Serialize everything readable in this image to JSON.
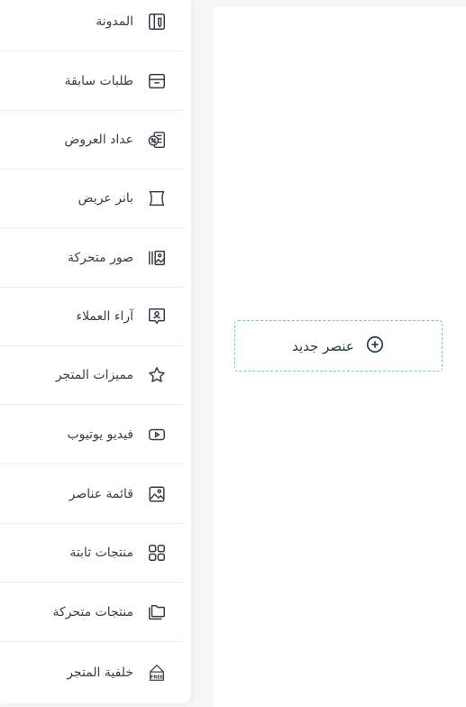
{
  "menu": {
    "items": [
      {
        "label": "المدونة",
        "icon": "blog-icon"
      },
      {
        "label": "طلبات سابقة",
        "icon": "box-icon"
      },
      {
        "label": "عداد العروض",
        "icon": "discount-timer-icon"
      },
      {
        "label": "بانر عريض",
        "icon": "banner-icon"
      },
      {
        "label": "صور متحركة",
        "icon": "slider-images-icon"
      },
      {
        "label": "آراء العملاء",
        "icon": "testimonial-icon"
      },
      {
        "label": "مميزات المتجر",
        "icon": "star-icon"
      },
      {
        "label": "فيديو يوتيوب",
        "icon": "youtube-icon"
      },
      {
        "label": "قائمة عناصر",
        "icon": "image-icon"
      },
      {
        "label": "منتجات ثابتة",
        "icon": "grid-icon"
      },
      {
        "label": "منتجات متحركة",
        "icon": "folders-icon"
      },
      {
        "label": "خلفية المتجر",
        "icon": "free-shop-icon"
      }
    ]
  },
  "add_element": {
    "label": "عنصر جديد",
    "icon": "plus-circle-icon"
  },
  "colors": {
    "accent_border": "#6fd0bc",
    "dark_text": "#1d3a46"
  }
}
